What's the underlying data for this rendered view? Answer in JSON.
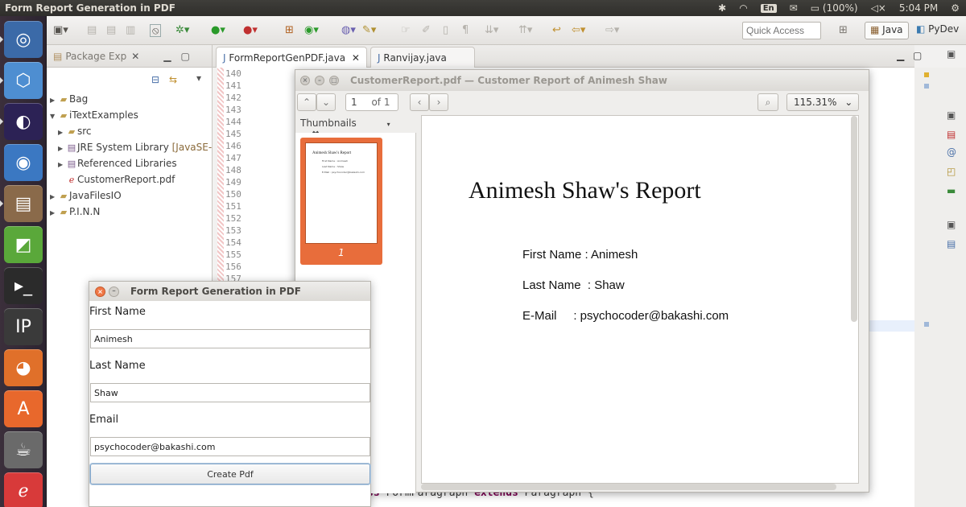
{
  "top_panel": {
    "window_title": "Form Report Generation in PDF",
    "keyboard_layout": "En",
    "battery": "(100%)",
    "clock": "5:04 PM"
  },
  "launcher": {
    "items": [
      {
        "icon": "ubuntu-dash-icon",
        "color": "#3b6aa8"
      },
      {
        "icon": "virtualbox-icon",
        "color": "#4e8ed1"
      },
      {
        "icon": "eclipse-icon",
        "color": "#2c2255"
      },
      {
        "icon": "chrome-icon",
        "color": "#3b78c2"
      },
      {
        "icon": "file-manager-icon",
        "color": "#8a6a4a"
      },
      {
        "icon": "pycharm-icon",
        "color": "#5aa83a"
      },
      {
        "icon": "terminal-icon",
        "color": "#2b2b2b"
      },
      {
        "icon": "ipython-icon",
        "color": "#3a3a3a"
      },
      {
        "icon": "firefox-icon",
        "color": "#e0702a"
      },
      {
        "icon": "software-center-icon",
        "color": "#e8682c"
      },
      {
        "icon": "java-icon",
        "color": "#6a6a6a"
      },
      {
        "icon": "pdf-viewer-icon",
        "color": "#d83a3a"
      }
    ]
  },
  "toolbar": {
    "quick_access_placeholder": "Quick Access",
    "perspectives": [
      "Java",
      "PyDev"
    ]
  },
  "package_explorer": {
    "tab_label": "Package Exp",
    "items": [
      {
        "label": "Bag",
        "icon": "project-folder-icon"
      },
      {
        "label": "iTextExamples",
        "icon": "project-folder-icon"
      },
      {
        "label": "src",
        "icon": "package-folder-icon"
      },
      {
        "label": "JRE System Library",
        "suffix": "[JavaSE-",
        "icon": "library-icon"
      },
      {
        "label": "Referenced Libraries",
        "icon": "library-icon"
      },
      {
        "label": "CustomerReport.pdf",
        "icon": "pdf-file-icon"
      },
      {
        "label": "JavaFilesIO",
        "icon": "project-folder-icon"
      },
      {
        "label": "P.I.N.N",
        "icon": "project-folder-icon"
      }
    ]
  },
  "editor": {
    "tabs": [
      "FormReportGenPDF.java",
      "Ranvijay.java"
    ],
    "line_numbers": [
      "140",
      "141",
      "142",
      "143",
      "144",
      "145",
      "146",
      "147",
      "148",
      "149",
      "150",
      "151",
      "152",
      "153",
      "154",
      "155",
      "156",
      "157"
    ],
    "visible_code": {
      "kw1": "ss",
      "mid": " FormParagraph ",
      "kw2": "extends",
      "tail": " Paragraph {"
    }
  },
  "pdf_viewer": {
    "title": "CustomerReport.pdf — Customer Report of Animesh Shaw",
    "page_input": "1",
    "page_of": "of 1",
    "zoom": "115.31%",
    "sidebar_label": "Thumbnails",
    "thumb_page_number": "1",
    "document": {
      "heading": "Animesh Shaw's Report",
      "lines": [
        "First Name : Animesh",
        "Last Name  : Shaw",
        "E-Mail     : psychocoder@bakashi.com"
      ]
    }
  },
  "form": {
    "title": "Form Report Generation in PDF",
    "first_name_label": "First Name",
    "first_name_value": "Animesh",
    "last_name_label": "Last Name",
    "last_name_value": "Shaw",
    "email_label": "Email",
    "email_value": "psychocoder@bakashi.com",
    "submit_label": "Create Pdf"
  }
}
